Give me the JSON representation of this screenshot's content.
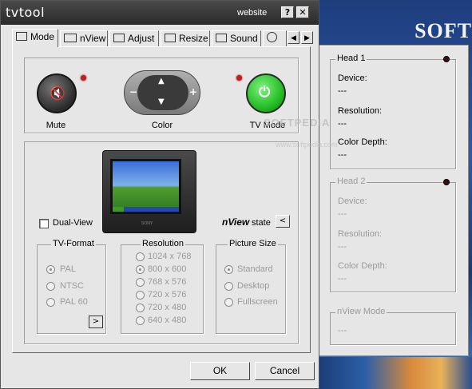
{
  "window": {
    "logo": "tvtool",
    "website_label": "website",
    "help_glyph": "?",
    "close_glyph": "✕"
  },
  "tabs": [
    {
      "label": "Mode",
      "icon": "monitor-icon"
    },
    {
      "label": "nView",
      "icon": "nview-icon"
    },
    {
      "label": "Adjust",
      "icon": "adjust-icon"
    },
    {
      "label": "Resize",
      "icon": "resize-icon"
    },
    {
      "label": "Sound",
      "icon": "sound-icon"
    }
  ],
  "tab_scroll": {
    "left": "◀",
    "right": "▶"
  },
  "controls": {
    "mute_label": "Mute",
    "color_label": "Color",
    "tvmode_label": "TV Mode",
    "pad_up": "▲",
    "pad_down": "▼",
    "pad_minus": "−",
    "pad_plus": "+"
  },
  "display": {
    "dual_view_label": "Dual-View",
    "nview_brand": "nView",
    "nview_state": " state",
    "nview_arrow": "<",
    "tv_brand": "SONY"
  },
  "tv_format": {
    "title": "TV-Format",
    "options": [
      "PAL",
      "NTSC",
      "PAL 60"
    ],
    "selected": "PAL",
    "more_button": ">"
  },
  "resolution": {
    "title": "Resolution",
    "options": [
      "1024 x 768",
      "800 x 600",
      "768 x 576",
      "720 x 576",
      "720 x 480",
      "640 x 480"
    ],
    "selected": "800 x 600"
  },
  "picture_size": {
    "title": "Picture Size",
    "options": [
      "Standard",
      "Desktop",
      "Fullscreen"
    ],
    "selected": "Standard"
  },
  "buttons": {
    "ok": "OK",
    "cancel": "Cancel"
  },
  "head1": {
    "title": "Head 1",
    "device_label": "Device:",
    "device_value": "---",
    "resolution_label": "Resolution:",
    "resolution_value": "---",
    "depth_label": "Color Depth:",
    "depth_value": "---"
  },
  "head2": {
    "title": "Head 2",
    "device_label": "Device:",
    "device_value": "---",
    "resolution_label": "Resolution:",
    "resolution_value": "---",
    "depth_label": "Color Depth:",
    "depth_value": "---"
  },
  "nview_mode": {
    "title": "nView Mode",
    "value": "---"
  },
  "background": {
    "brand_text": "SOFT"
  },
  "watermark": {
    "text": "SOFTPEDIA",
    "url": "www.softpedia.com"
  }
}
